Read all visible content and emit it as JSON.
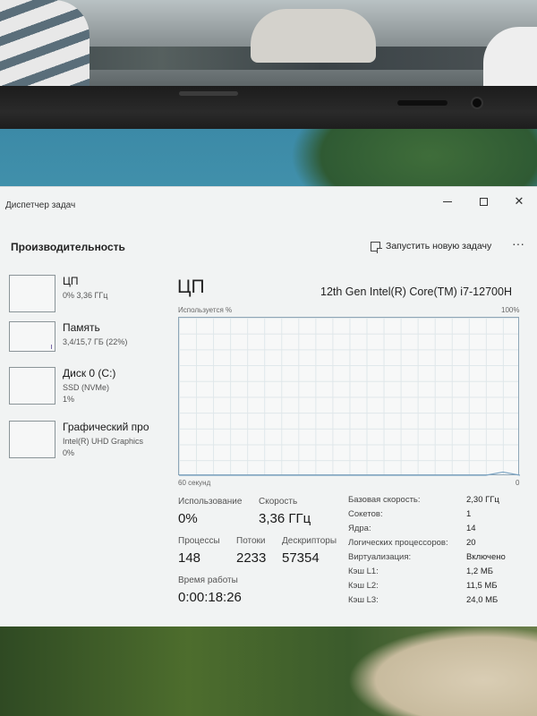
{
  "window": {
    "title": "Диспетчер задач",
    "section_title": "Производительность",
    "run_task_label": "Запустить новую задачу",
    "more_label": "···"
  },
  "sidebar": {
    "items": [
      {
        "name": "ЦП",
        "sub1": "0% 3,36 ГГц",
        "sub2": ""
      },
      {
        "name": "Память",
        "sub1": "3,4/15,7 ГБ (22%)",
        "sub2": ""
      },
      {
        "name": "Диск 0 (C:)",
        "sub1": "SSD (NVMe)",
        "sub2": "1%"
      },
      {
        "name": "Графический про",
        "sub1": "Intel(R) UHD Graphics",
        "sub2": "0%"
      }
    ]
  },
  "main": {
    "title": "ЦП",
    "model": "12th Gen Intel(R) Core(TM) i7-12700H",
    "graph_label_top_left": "Используется %",
    "graph_label_top_right": "100%",
    "graph_label_bottom_left": "60 секунд",
    "graph_label_bottom_right": "0",
    "graph_usage_series": [
      0,
      0,
      0,
      0,
      0,
      0,
      0,
      0,
      0,
      0,
      0,
      0,
      0,
      0,
      0,
      0,
      0,
      0,
      0,
      2,
      0
    ]
  },
  "stats": {
    "usage_label": "Использование",
    "usage_value": "0%",
    "speed_label": "Скорость",
    "speed_value": "3,36 ГГц",
    "processes_label": "Процессы",
    "processes_value": "148",
    "threads_label": "Потоки",
    "threads_value": "2233",
    "handles_label": "Дескрипторы",
    "handles_value": "57354",
    "uptime_label": "Время работы",
    "uptime_value": "0:00:18:26"
  },
  "specs": [
    {
      "key": "Базовая скорость:",
      "value": "2,30 ГГц"
    },
    {
      "key": "Сокетов:",
      "value": "1"
    },
    {
      "key": "Ядра:",
      "value": "14"
    },
    {
      "key": "Логических процессоров:",
      "value": "20"
    },
    {
      "key": "Виртуализация:",
      "value": "Включено"
    },
    {
      "key": "Кэш L1:",
      "value": "1,2 МБ"
    },
    {
      "key": "Кэш L2:",
      "value": "11,5 МБ"
    },
    {
      "key": "Кэш L3:",
      "value": "24,0 МБ"
    }
  ],
  "colors": {
    "graph_line": "#7aa3c2",
    "graph_border": "#8ea6b7",
    "window_bg": "#f1f3f3"
  }
}
